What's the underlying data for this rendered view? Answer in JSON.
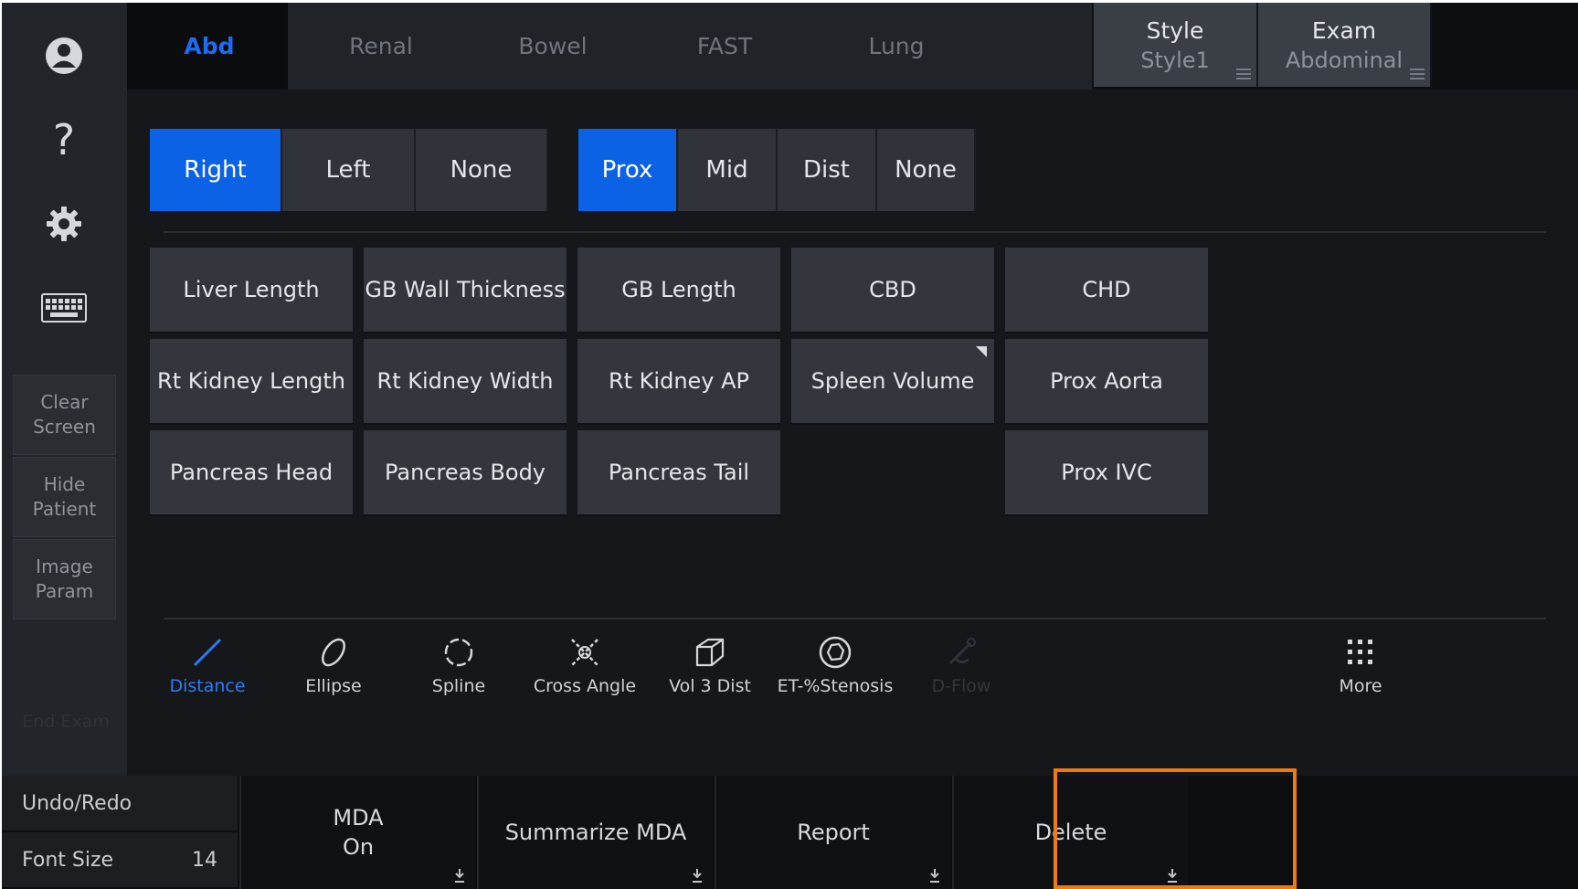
{
  "tabs": [
    {
      "label": "Abd",
      "active": true
    },
    {
      "label": "Renal",
      "active": false
    },
    {
      "label": "Bowel",
      "active": false
    },
    {
      "label": "FAST",
      "active": false
    },
    {
      "label": "Lung",
      "active": false
    }
  ],
  "style_select": {
    "label": "Style",
    "value": "Style1"
  },
  "exam_select": {
    "label": "Exam",
    "value": "Abdominal"
  },
  "sidebar": {
    "icons": [
      "user-icon",
      "help-icon",
      "gear-icon",
      "keyboard-icon"
    ],
    "help_glyph": "?",
    "buttons": [
      "Clear Screen",
      "Hide Patient",
      "Image Param"
    ],
    "faded": "End Exam"
  },
  "side_selector": [
    {
      "label": "Right",
      "selected": true
    },
    {
      "label": "Left",
      "selected": false
    },
    {
      "label": "None",
      "selected": false
    }
  ],
  "location_selector": [
    {
      "label": "Prox",
      "selected": true
    },
    {
      "label": "Mid",
      "selected": false
    },
    {
      "label": "Dist",
      "selected": false
    },
    {
      "label": "None",
      "selected": false
    }
  ],
  "measurements": {
    "row1": [
      "Liver Length",
      "GB Wall Thickness",
      "GB Length",
      "CBD",
      "CHD"
    ],
    "row2": [
      "Rt  Kidney Length",
      "Rt  Kidney Width",
      "Rt  Kidney AP",
      "Spleen Volume",
      "Prox Aorta"
    ],
    "row3": [
      "Pancreas Head",
      "Pancreas Body",
      "Pancreas Tail",
      "Prox IVC"
    ]
  },
  "tools": [
    {
      "label": "Distance",
      "icon": "line-icon",
      "active": true
    },
    {
      "label": "Ellipse",
      "icon": "ellipse-icon"
    },
    {
      "label": "Spline",
      "icon": "spline-icon"
    },
    {
      "label": "Cross Angle",
      "icon": "cross-angle-icon"
    },
    {
      "label": "Vol 3 Dist",
      "icon": "cube-icon"
    },
    {
      "label": "ET-%Stenosis",
      "icon": "stenosis-icon"
    },
    {
      "label": "D-Flow",
      "icon": "flow-icon",
      "disabled": true
    },
    {
      "label": "More",
      "icon": "grid-icon"
    }
  ],
  "bottom": {
    "undo_redo": "Undo/Redo",
    "font_size_label": "Font Size",
    "font_size_value": "14",
    "mda_label": "MDA",
    "mda_state": "On",
    "summarize": "Summarize MDA",
    "report": "Report",
    "delete": "Delete"
  },
  "colors": {
    "accent": "#0b62e4",
    "highlight": "#f07a12"
  }
}
